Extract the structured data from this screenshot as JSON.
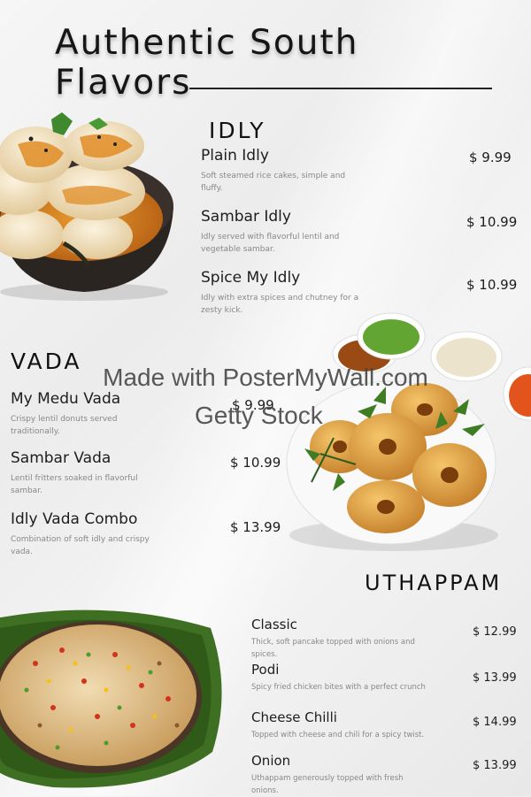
{
  "title": "Authentic South Flavors",
  "sections": {
    "idly": {
      "title": "IDLY",
      "items": [
        {
          "name": "Plain Idly",
          "description": "Soft steamed rice cakes, simple and fluffy.",
          "price": "$ 9.99"
        },
        {
          "name": "Sambar Idly",
          "description": "Idly served with flavorful lentil and vegetable sambar.",
          "price": "$ 10.99"
        },
        {
          "name": "Spice My Idly",
          "description": "Idly with extra spices and chutney for a zesty kick.",
          "price": "$ 10.99"
        }
      ]
    },
    "vada": {
      "title": "VADA",
      "items": [
        {
          "name": "My Medu Vada",
          "description": "Crispy lentil donuts served traditionally.",
          "price": "$ 9.99"
        },
        {
          "name": "Sambar Vada",
          "description": "Lentil fritters soaked in flavorful sambar.",
          "price": "$ 10.99"
        },
        {
          "name": "Idly Vada Combo",
          "description": "Combination of soft idly and crispy vada.",
          "price": "$ 13.99"
        }
      ]
    },
    "uthappam": {
      "title": "UTHAPPAM",
      "items": [
        {
          "name": "Classic",
          "description": "Thick, soft pancake topped with onions and spices.",
          "price": "$ 12.99"
        },
        {
          "name": "Podi",
          "description": "Spicy fried chicken bites with a perfect crunch",
          "price": "$ 13.99"
        },
        {
          "name": "Cheese Chilli",
          "description": "Topped with cheese and chili for a spicy twist.",
          "price": "$ 14.99"
        },
        {
          "name": "Onion",
          "description": "Uthappam generously topped with fresh onions.",
          "price": "$ 13.99"
        }
      ]
    }
  },
  "watermark": {
    "line1": "Made with PosterMyWall.com",
    "line2": "Getty Stock"
  },
  "colors": {
    "text": "#1d1d1d",
    "description": "#888888",
    "background": "#f0f0f0"
  },
  "images": [
    "idly-sambar-bowl-photo",
    "medu-vada-chutney-plate-photo",
    "uthappam-banana-leaf-photo"
  ]
}
